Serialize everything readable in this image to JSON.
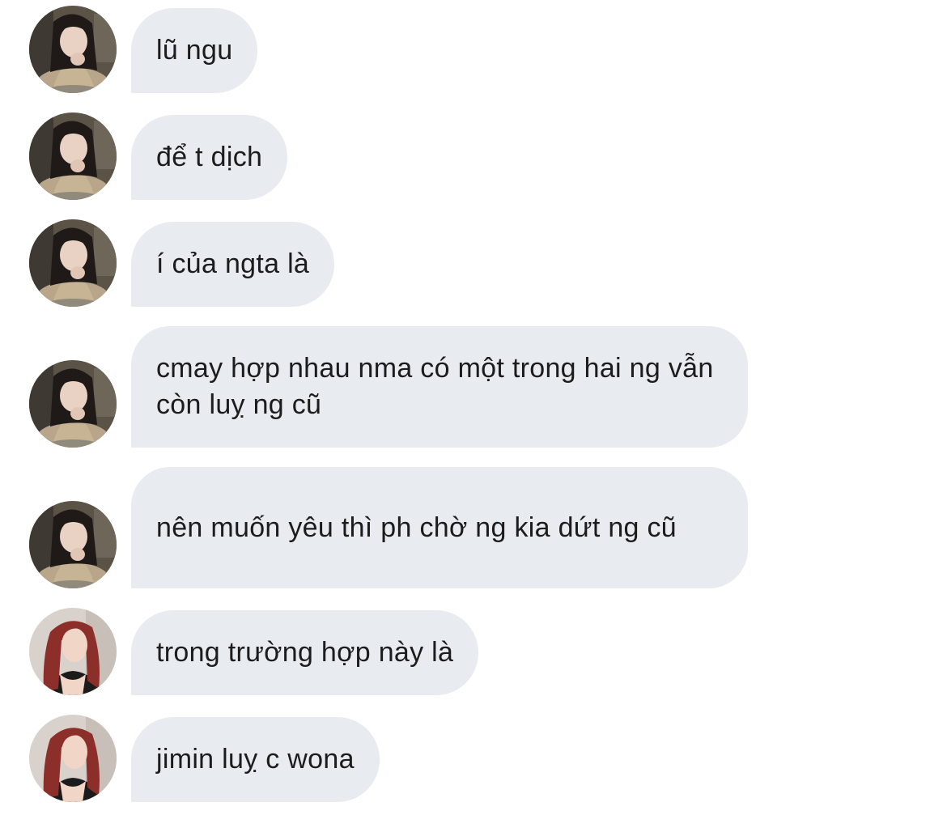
{
  "avatars": {
    "user_a": {
      "icon": "avatar-photo-dark-hair-girl",
      "bg": "#5b5346",
      "skin": "#e9d2c4",
      "hair": "#1f1a17",
      "sweater": "#b8a58a"
    },
    "user_b": {
      "icon": "avatar-photo-red-hair-girl",
      "bg": "#d9d2cc",
      "skin": "#f1d6c7",
      "hair": "#8c2f2a",
      "top": "#1b1b1b"
    }
  },
  "bubble_color": "#e8ecf0",
  "messages": [
    {
      "sender": "user_a",
      "text": "lũ ngu"
    },
    {
      "sender": "user_a",
      "text": "để t dịch"
    },
    {
      "sender": "user_a",
      "text": "í của ngta là"
    },
    {
      "sender": "user_a",
      "text": "cmay hợp nhau nma có một trong hai ng vẫn còn luỵ ng cũ"
    },
    {
      "sender": "user_a",
      "text": "nên muốn yêu thì ph chờ ng kia dứt ng cũ"
    },
    {
      "sender": "user_b",
      "text": "trong trường hợp này là"
    },
    {
      "sender": "user_b",
      "text": "jimin luỵ c wona"
    }
  ]
}
